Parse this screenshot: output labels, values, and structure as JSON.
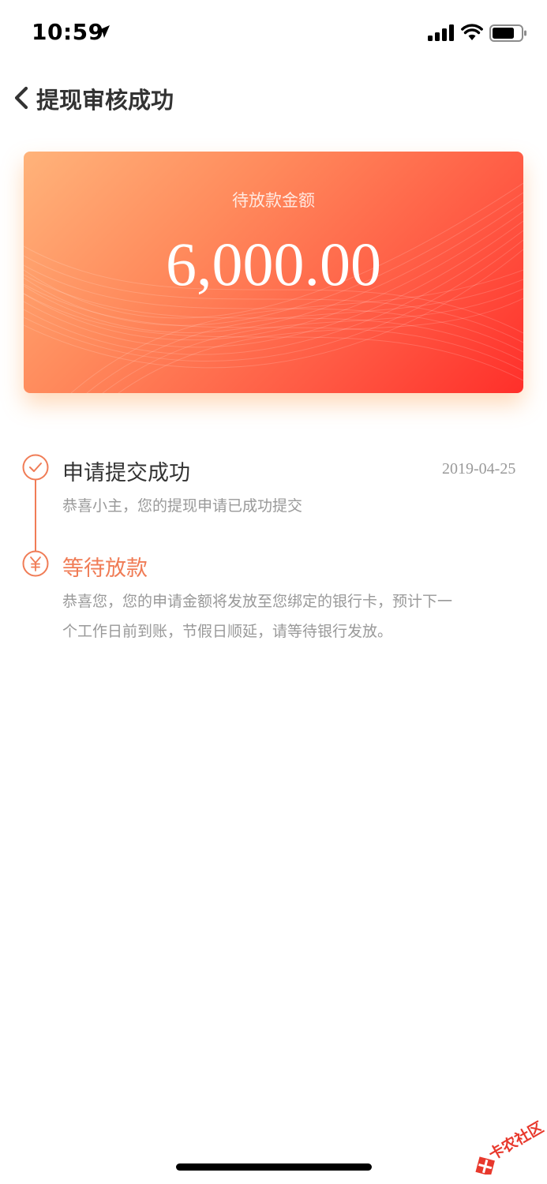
{
  "status_bar": {
    "time": "10:59",
    "icons": [
      "location-arrow-icon",
      "signal-icon",
      "wifi-icon",
      "battery-icon"
    ]
  },
  "nav": {
    "back_icon": "chevron-left-icon",
    "title": "提现审核成功"
  },
  "card": {
    "label": "待放款金额",
    "amount": "6,000.00",
    "colors": {
      "gradient_start": "#ffb37a",
      "gradient_end": "#ff2f2a"
    }
  },
  "timeline": {
    "accent_color": "#f07c56",
    "steps": [
      {
        "icon": "check-circle-icon",
        "title": "申请提交成功",
        "date": "2019-04-25",
        "description": "恭喜小主，您的提现申请已成功提交"
      },
      {
        "icon": "yuan-circle-icon",
        "title": "等待放款",
        "description_line1": "恭喜您，您的申请金额将发放至您绑定的银行卡，预计下一",
        "description_line2": "个工作日前到账，节假日顺延，请等待银行发放。"
      }
    ]
  },
  "watermark": {
    "text": "卡农社区"
  }
}
